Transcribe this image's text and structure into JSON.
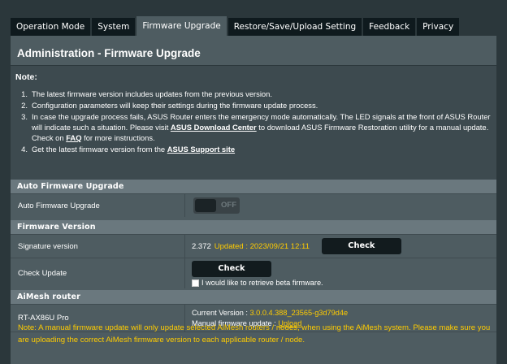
{
  "tabs": [
    {
      "label": "Operation Mode"
    },
    {
      "label": "System"
    },
    {
      "label": "Firmware Upgrade"
    },
    {
      "label": "Restore/Save/Upload Setting"
    },
    {
      "label": "Feedback"
    },
    {
      "label": "Privacy"
    }
  ],
  "active_tab_index": 2,
  "page": {
    "title": "Administration - Firmware Upgrade",
    "note_label": "Note:",
    "notes": [
      {
        "num": "1.",
        "text": "The latest firmware version includes updates from the previous version."
      },
      {
        "num": "2.",
        "text": "Configuration parameters will keep their settings during the firmware update process."
      },
      {
        "num": "3.",
        "text_a": "In case the upgrade process fails, ASUS Router enters the emergency mode automatically. The LED signals at the front of ASUS Router will indicate such a situation. Please visit ",
        "link1": "ASUS Download Center",
        "text_b": " to download ASUS Firmware Restoration utility for a manual update. Check on ",
        "link2": "FAQ",
        "text_c": " for more instructions."
      },
      {
        "num": "4.",
        "text_a": "Get the latest firmware version from the ",
        "link1": "ASUS Support site"
      }
    ]
  },
  "auto_upgrade": {
    "header": "Auto Firmware Upgrade",
    "label": "Auto Firmware Upgrade",
    "toggle_state": "OFF"
  },
  "firmware_version": {
    "header": "Firmware Version",
    "signature_label": "Signature version",
    "signature_value": "2.372",
    "signature_updated": "Updated : 2023/09/21 12:11",
    "check_button": "Check",
    "check_update_label": "Check Update",
    "check_update_button": "Check",
    "beta_checkbox_label": "I would like to retrieve beta firmware.",
    "beta_checked": false
  },
  "aimesh": {
    "header": "AiMesh router",
    "model": "RT-AX86U Pro",
    "current_version_label": "Current Version :",
    "current_version_value": "3.0.0.4.388_23565-g3d79d4e",
    "manual_update_label": "Manual firmware update :",
    "manual_update_link": "Upload"
  },
  "bottom_note": "Note: A manual firmware update will only update selected AiMesh routers / nodes, when using the AiMesh system. Please make sure you are uploading the correct AiMesh firmware version to each applicable router / node.",
  "colors": {
    "background": "#2b373b",
    "panel": "#4e5c61",
    "accent_orange": "#ffcc00",
    "button": "#121b1e"
  }
}
